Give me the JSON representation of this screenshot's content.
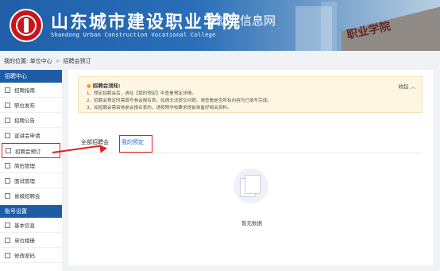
{
  "header": {
    "school_name_cn": "山东城市建设职业学院",
    "school_name_en": "Shandong Urban Construction Vocational College",
    "site_title": "就业信息网",
    "stone_text": "职业学院"
  },
  "breadcrumb": {
    "prefix": "我的位置:",
    "level1": "单位中心",
    "sep": ">",
    "level2": "招聘会预订"
  },
  "sidebar": {
    "section1_title": "招聘中心",
    "section1_items": [
      "招聘指南",
      "职位发布",
      "招聘公告",
      "宣讲会申请",
      "招聘会预订",
      "简历管理",
      "面试管理",
      "省级招聘会"
    ],
    "section2_title": "账号设置",
    "section2_items": [
      "基本信息",
      "单位相册",
      "修改密码"
    ]
  },
  "notice": {
    "title": "招聘会须知:",
    "collapse_label": "收起",
    "lines": [
      "1、预定招聘会后，请在【我的预定】中查看预定详情。",
      "2、招聘会预定时需填写参会报名表，如遇无法提交问题，请查看是否所有内容均已填写完成。",
      "3、如招聘会需审核参会报名表的，请按照学校要求提前准备好相关资料。"
    ]
  },
  "tabs": {
    "all": "全部招聘会",
    "mine": "我的预定"
  },
  "empty": {
    "text": "暂无数据"
  },
  "colors": {
    "primary": "#1e5ca8",
    "highlight": "#e02020",
    "link": "#1e6fd9",
    "notice_bg": "#fff6e1"
  }
}
